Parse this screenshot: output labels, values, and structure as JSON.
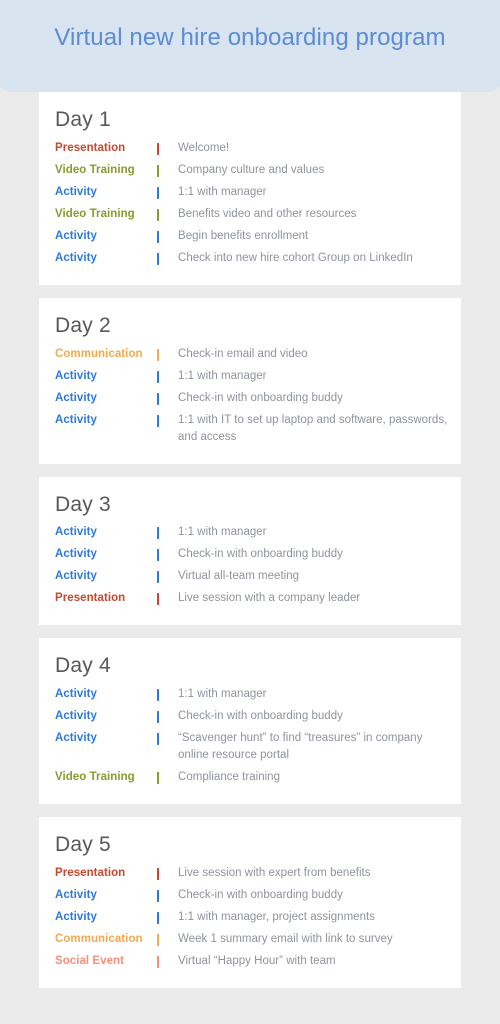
{
  "header": {
    "title": "Virtual new hire onboarding program",
    "title_color": "#5b8cd4",
    "banner_color": "#d9e4f1"
  },
  "page": {
    "background_color": "#ebebeb",
    "card_background_color": "#ffffff",
    "card_title_color": "#585858",
    "description_color": "#8e939c"
  },
  "category_colors": {
    "Presentation": "#c4492f",
    "Video Training": "#8a9a2e",
    "Activity": "#2f79d8",
    "Communication": "#f0ab4e",
    "Social Event": "#f5907a"
  },
  "days": [
    {
      "title": "Day 1",
      "rows": [
        {
          "category": "Presentation",
          "color": "#c4492f",
          "description": "Welcome!"
        },
        {
          "category": "Video Training",
          "color": "#8a9a2e",
          "description": "Company culture and values"
        },
        {
          "category": "Activity",
          "color": "#2f79d8",
          "description": "1:1 with manager"
        },
        {
          "category": "Video Training",
          "color": "#8a9a2e",
          "description": "Benefits video and other resources"
        },
        {
          "category": "Activity",
          "color": "#2f79d8",
          "description": "Begin benefits enrollment"
        },
        {
          "category": "Activity",
          "color": "#2f79d8",
          "description": "Check into new hire cohort Group on LinkedIn"
        }
      ]
    },
    {
      "title": "Day 2",
      "rows": [
        {
          "category": "Communication",
          "color": "#f0ab4e",
          "description": "Check-in email and video"
        },
        {
          "category": "Activity",
          "color": "#2f79d8",
          "description": "1:1 with manager"
        },
        {
          "category": "Activity",
          "color": "#2f79d8",
          "description": "Check-in with onboarding buddy"
        },
        {
          "category": "Activity",
          "color": "#2f79d8",
          "description": "1:1 with IT to set up laptop and software, passwords, and access"
        }
      ]
    },
    {
      "title": "Day 3",
      "rows": [
        {
          "category": "Activity",
          "color": "#2f79d8",
          "description": "1:1 with manager"
        },
        {
          "category": "Activity",
          "color": "#2f79d8",
          "description": "Check-in with onboarding buddy"
        },
        {
          "category": "Activity",
          "color": "#2f79d8",
          "description": "Virtual all-team meeting"
        },
        {
          "category": "Presentation",
          "color": "#c4492f",
          "description": "Live session with a company leader"
        }
      ]
    },
    {
      "title": "Day 4",
      "rows": [
        {
          "category": "Activity",
          "color": "#2f79d8",
          "description": "1:1 with manager"
        },
        {
          "category": "Activity",
          "color": "#2f79d8",
          "description": "Check-in with onboarding buddy"
        },
        {
          "category": "Activity",
          "color": "#2f79d8",
          "description": "“Scavenger hunt” to find “treasures” in company online resource portal"
        },
        {
          "category": "Video Training",
          "color": "#8a9a2e",
          "description": "Compliance training"
        }
      ]
    },
    {
      "title": "Day 5",
      "rows": [
        {
          "category": "Presentation",
          "color": "#c4492f",
          "description": "Live session with expert from benefits"
        },
        {
          "category": "Activity",
          "color": "#2f79d8",
          "description": "Check-in with onboarding buddy"
        },
        {
          "category": "Activity",
          "color": "#2f79d8",
          "description": "1:1 with manager, project assignments"
        },
        {
          "category": "Communication",
          "color": "#f0ab4e",
          "description": "Week 1 summary email with link to survey"
        },
        {
          "category": "Social Event",
          "color": "#f5907a",
          "description": "Virtual “Happy Hour” with team"
        }
      ]
    }
  ]
}
